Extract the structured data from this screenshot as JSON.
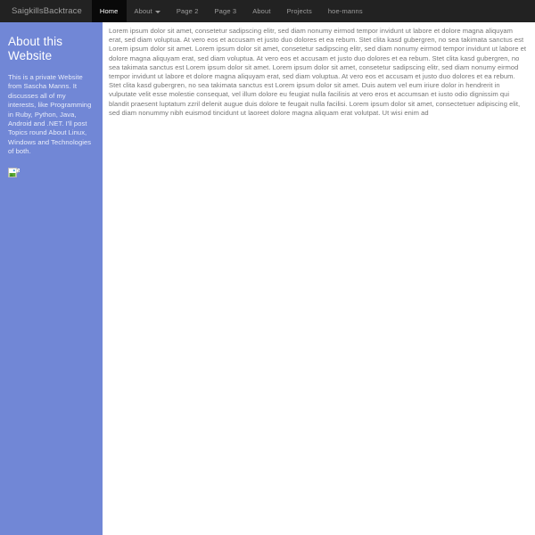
{
  "navbar": {
    "brand": "SaigkillsBacktrace",
    "items": [
      {
        "label": "Home",
        "active": true,
        "caret": false
      },
      {
        "label": "About",
        "active": false,
        "caret": true
      },
      {
        "label": "Page 2",
        "active": false,
        "caret": false
      },
      {
        "label": "Page 3",
        "active": false,
        "caret": false
      },
      {
        "label": "About",
        "active": false,
        "caret": false
      },
      {
        "label": "Projects",
        "active": false,
        "caret": false
      },
      {
        "label": "hoe-manns",
        "active": false,
        "caret": false
      }
    ]
  },
  "sidebar": {
    "title": "About this Website",
    "body": "This is a private Website from Sascha Manns. It discusses all of my interests, like Programming in Ruby, Python, Java, Android and .NET. I'll post Topics round About Linux, Windows and Technologies of both.",
    "image_alt": "broken-image"
  },
  "main": {
    "paragraph": "Lorem ipsum dolor sit amet, consetetur sadipscing elitr, sed diam nonumy eirmod tempor invidunt ut labore et dolore magna aliquyam erat, sed diam voluptua. At vero eos et accusam et justo duo dolores et ea rebum. Stet clita kasd gubergren, no sea takimata sanctus est Lorem ipsum dolor sit amet. Lorem ipsum dolor sit amet, consetetur sadipscing elitr, sed diam nonumy eirmod tempor invidunt ut labore et dolore magna aliquyam erat, sed diam voluptua. At vero eos et accusam et justo duo dolores et ea rebum. Stet clita kasd gubergren, no sea takimata sanctus est Lorem ipsum dolor sit amet. Lorem ipsum dolor sit amet, consetetur sadipscing elitr, sed diam nonumy eirmod tempor invidunt ut labore et dolore magna aliquyam erat, sed diam voluptua. At vero eos et accusam et justo duo dolores et ea rebum. Stet clita kasd gubergren, no sea takimata sanctus est Lorem ipsum dolor sit amet. Duis autem vel eum iriure dolor in hendrerit in vulputate velit esse molestie consequat, vel illum dolore eu feugiat nulla facilisis at vero eros et accumsan et iusto odio dignissim qui blandit praesent luptatum zzril delenit augue duis dolore te feugait nulla facilisi. Lorem ipsum dolor sit amet, consectetuer adipiscing elit, sed diam nonummy nibh euismod tincidunt ut laoreet dolore magna aliquam erat volutpat. Ut wisi enim ad"
  },
  "colors": {
    "navbar_bg": "#222222",
    "navbar_active_bg": "#090909",
    "navbar_text": "#9d9d9d",
    "sidebar_bg": "#7187d6",
    "content_text": "#777777",
    "page_bg": "#ffffff"
  }
}
